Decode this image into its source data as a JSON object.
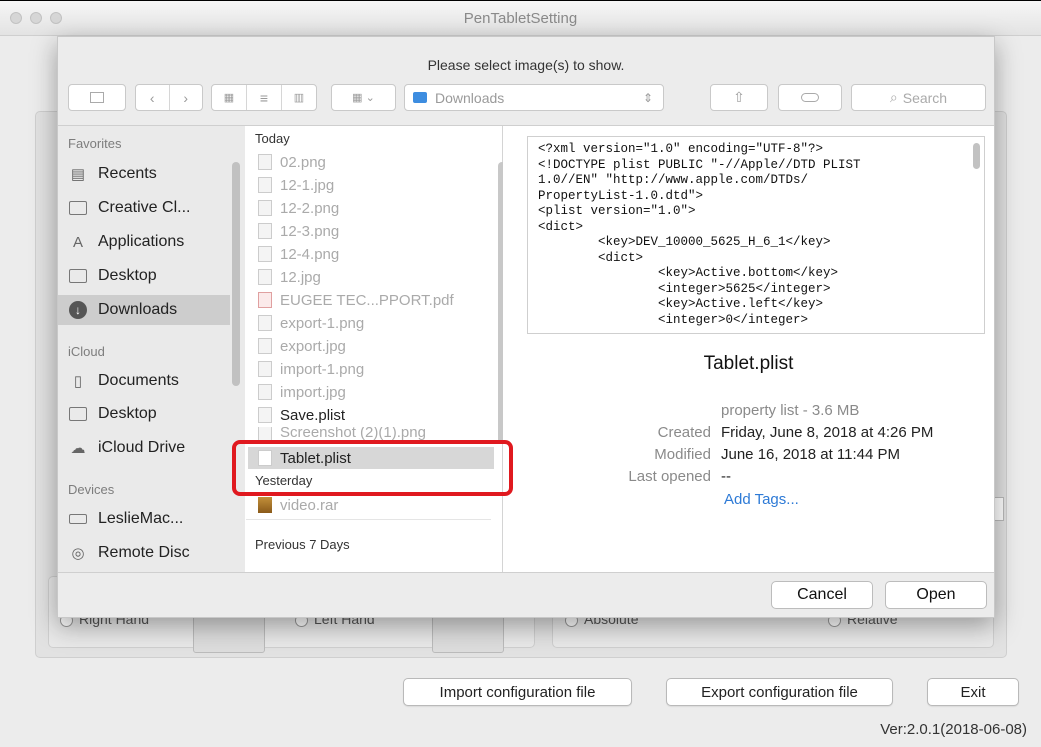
{
  "window": {
    "title": "PenTabletSetting"
  },
  "dialog": {
    "message": "Please select image(s) to show.",
    "path_popup": "Downloads",
    "search_placeholder": "Search",
    "cancel_label": "Cancel",
    "open_label": "Open"
  },
  "sidebar": {
    "favorites_label": "Favorites",
    "favorites": [
      {
        "label": "Recents"
      },
      {
        "label": "Creative Cl..."
      },
      {
        "label": "Applications"
      },
      {
        "label": "Desktop"
      },
      {
        "label": "Downloads",
        "selected": true
      }
    ],
    "icloud_label": "iCloud",
    "icloud": [
      {
        "label": "Documents"
      },
      {
        "label": "Desktop"
      },
      {
        "label": "iCloud Drive"
      }
    ],
    "devices_label": "Devices",
    "devices": [
      {
        "label": "LeslieMac..."
      },
      {
        "label": "Remote Disc"
      }
    ]
  },
  "files": {
    "today_label": "Today",
    "today": [
      {
        "name": "02.png"
      },
      {
        "name": "12-1.jpg"
      },
      {
        "name": "12-2.png"
      },
      {
        "name": "12-3.png"
      },
      {
        "name": "12-4.png"
      },
      {
        "name": "12.jpg"
      },
      {
        "name": "EUGEE TEC...PPORT.pdf"
      },
      {
        "name": "export-1.png"
      },
      {
        "name": "export.jpg"
      },
      {
        "name": "import-1.png"
      },
      {
        "name": "import.jpg"
      },
      {
        "name": "Save.plist"
      },
      {
        "name": "Screenshot (2)(1).png"
      },
      {
        "name": "Tablet.plist",
        "selected": true
      }
    ],
    "yesterday_label": "Yesterday",
    "yesterday": [
      {
        "name": "video.rar"
      }
    ],
    "previous_label": "Previous 7 Days"
  },
  "preview": {
    "content": "<?xml version=\"1.0\" encoding=\"UTF-8\"?>\n<!DOCTYPE plist PUBLIC \"-//Apple//DTD PLIST\n1.0//EN\" \"http://www.apple.com/DTDs/\nPropertyList-1.0.dtd\">\n<plist version=\"1.0\">\n<dict>\n        <key>DEV_10000_5625_H_6_1</key>\n        <dict>\n                <key>Active.bottom</key>\n                <integer>5625</integer>\n                <key>Active.left</key>\n                <integer>0</integer>",
    "filename": "Tablet.plist",
    "kind": "property list - 3.6 MB",
    "created_label": "Created",
    "created_value": "Friday, June 8, 2018 at 4:26 PM",
    "modified_label": "Modified",
    "modified_value": "June 16, 2018 at 11:44 PM",
    "last_opened_label": "Last opened",
    "last_opened_value": "--",
    "add_tags": "Add Tags..."
  },
  "background": {
    "right_hand": "Right Hand",
    "left_hand": "Left Hand",
    "absolute": "Absolute",
    "relative": "Relative"
  },
  "footer": {
    "import_label": "Import configuration file",
    "export_label": "Export configuration file",
    "exit_label": "Exit",
    "version": "Ver:2.0.1(2018-06-08)"
  },
  "colors": {
    "highlight": "#e0191f",
    "accent": "#2d7ad6"
  }
}
